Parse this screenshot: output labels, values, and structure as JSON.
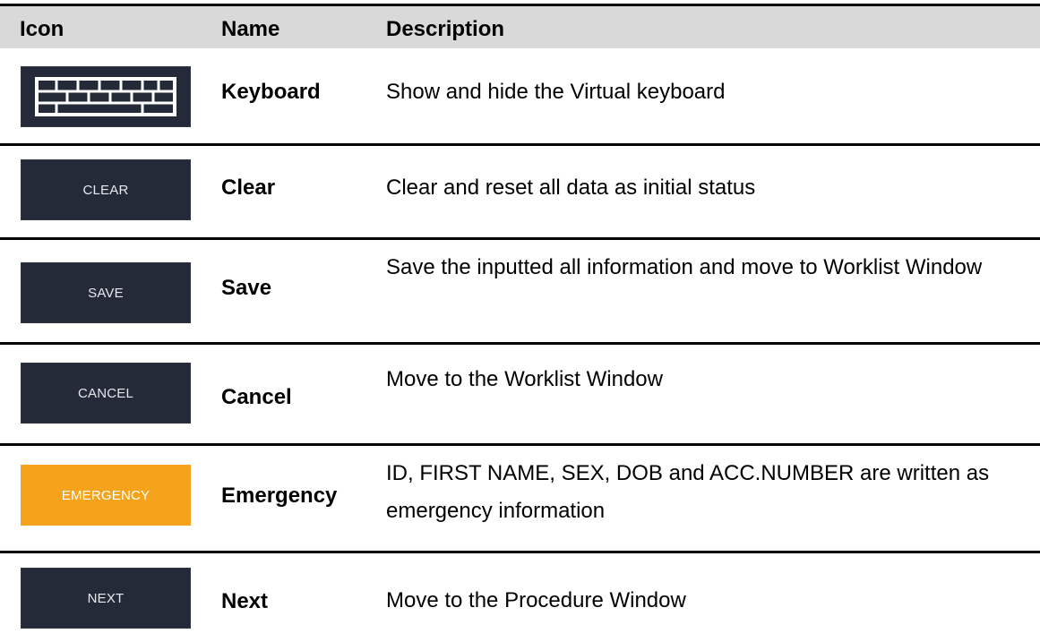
{
  "header": {
    "col_icon": "Icon",
    "col_name": "Name",
    "col_description": "Description"
  },
  "rows": [
    {
      "icon_label": "",
      "icon_name": "keyboard-icon",
      "name": "Keyboard",
      "description": "Show and hide the Virtual keyboard"
    },
    {
      "icon_label": "CLEAR",
      "icon_name": "clear-button-icon",
      "name": "Clear",
      "description": "Clear and reset all data as initial status"
    },
    {
      "icon_label": "SAVE",
      "icon_name": "save-button-icon",
      "name": "Save",
      "description": "Save the inputted all information and move to Worklist Window"
    },
    {
      "icon_label": "CANCEL",
      "icon_name": "cancel-button-icon",
      "name": "Cancel",
      "description": "Move to the Worklist Window"
    },
    {
      "icon_label": "EMERGENCY",
      "icon_name": "emergency-button-icon",
      "name": "Emergency",
      "description": "ID, FIRST NAME, SEX, DOB and ACC.NUMBER are written as emergency information"
    },
    {
      "icon_label": "NEXT",
      "icon_name": "next-button-icon",
      "name": "Next",
      "description": "Move to the Procedure Window"
    }
  ],
  "colors": {
    "button_bg": "#242a37",
    "emergency_bg": "#f5a31a",
    "header_bg": "#d9d9d9"
  }
}
